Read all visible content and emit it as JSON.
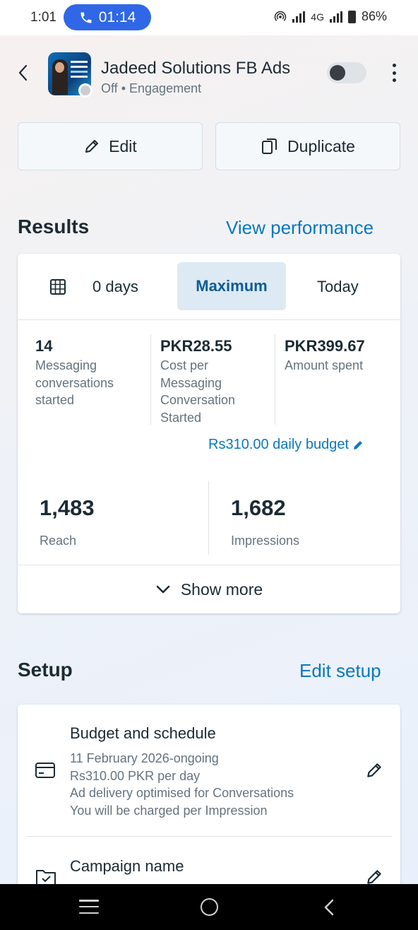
{
  "status_bar": {
    "time": "1:01",
    "call_timer": "01:14",
    "network": "4G",
    "battery": "86%"
  },
  "header": {
    "campaign_name": "Jadeed Solutions FB Ads",
    "status": "Off",
    "objective": "Engagement",
    "toggle_on": false
  },
  "actions": {
    "edit_label": "Edit",
    "duplicate_label": "Duplicate"
  },
  "results": {
    "title": "Results",
    "link": "View performance",
    "tabs": {
      "days_label": "0 days",
      "maximum_label": "Maximum",
      "today_label": "Today",
      "selected": "Maximum"
    },
    "metrics": [
      {
        "value": "14",
        "label_lines": [
          "Messaging",
          "conversations",
          "started"
        ]
      },
      {
        "value": "PKR28.55",
        "label_lines": [
          "Cost per",
          "Messaging",
          "Conversation",
          "Started"
        ]
      },
      {
        "value": "PKR399.67",
        "label_lines": [
          "Amount spent"
        ]
      }
    ],
    "daily_budget": "Rs310.00 daily budget",
    "reach": {
      "value": "1,483",
      "label": "Reach"
    },
    "impressions": {
      "value": "1,682",
      "label": "Impressions"
    },
    "show_more": "Show more"
  },
  "setup": {
    "title": "Setup",
    "link": "Edit setup",
    "budget_schedule": {
      "title": "Budget and schedule",
      "lines": [
        "11 February 2026-ongoing",
        "Rs310.00 PKR per day",
        "Ad delivery optimised for Conversations",
        "You will be charged per Impression"
      ]
    },
    "campaign_name_row": {
      "title": "Campaign name"
    }
  },
  "colors": {
    "accent": "#0a78be",
    "call_pill": "#2f67e6",
    "selected_tab_bg": "#dde9f3"
  }
}
